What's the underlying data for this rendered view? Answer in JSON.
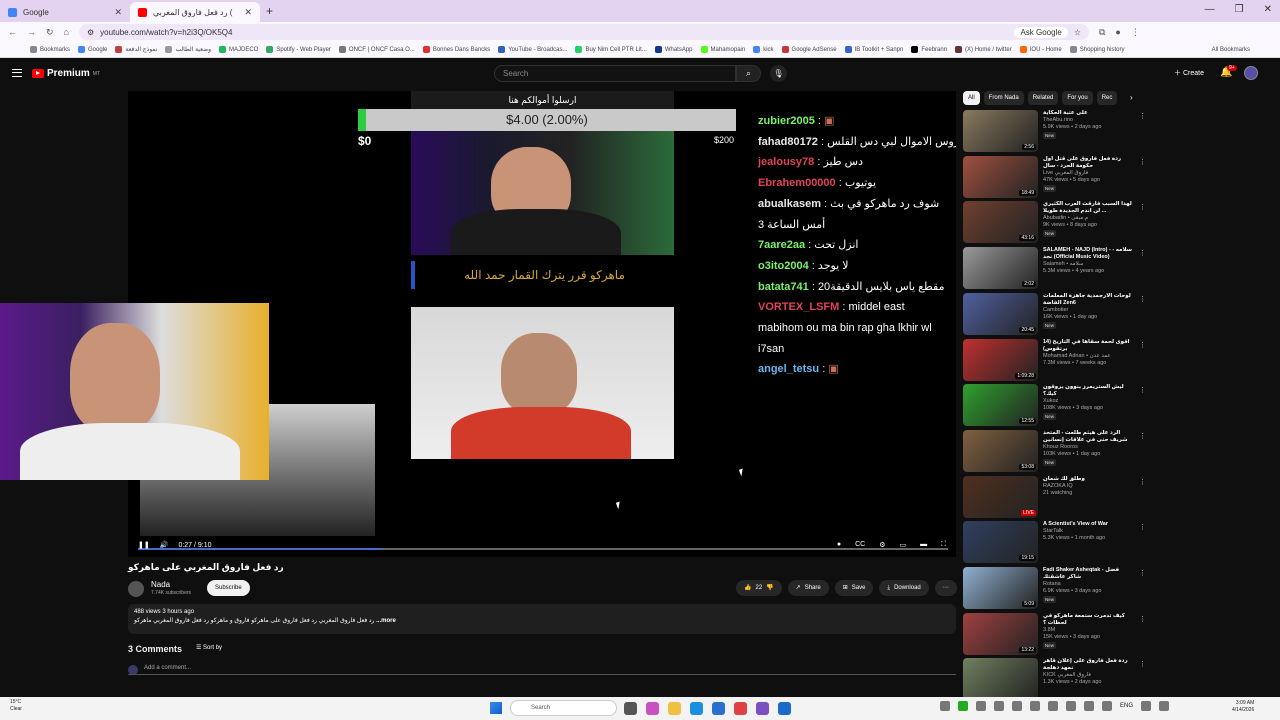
{
  "browser": {
    "tabs": [
      {
        "label": "Google"
      },
      {
        "label": "رد فعل فاروق المغربي (NOOB) -"
      }
    ],
    "url": "youtube.com/watch?v=h2i3Q/OK5Q4",
    "ask_google": "Ask Google",
    "bookmarks": [
      "Bookmarks",
      "Google",
      "نموذج الدفعة",
      "وضعية الطالب",
      "MAJDECO",
      "Spotify - Web Player",
      "ONCF | ONCF Casa O...",
      "Bonnes Dans Bancks",
      "YouTube - Broadcas...",
      "Buy Nim Cell PTR Lit...",
      "WhatsApp",
      "Mahamopain",
      "kick",
      "Google AdSense",
      "IB TooIkit + Sanpn",
      "Feebrann",
      "(X) Home / twitter",
      "IOU - Home",
      "Shopping history"
    ],
    "all_bookmarks": "All Bookmarks"
  },
  "yt": {
    "logo": "Premium",
    "logo_sup": "MT",
    "search_placeholder": "Search",
    "create": "Create",
    "notif_count": "9+"
  },
  "stream": {
    "banner": "ارسلوا أموالكم هنا",
    "donation": "$4.00 (2.00%)",
    "don_min": "$0",
    "don_max": "$200",
    "title_strip": "ماهركو قرر يترك القمار حمد الله",
    "chat": [
      {
        "user": "zubier2005",
        "msg": "",
        "color": "#7cf06a"
      },
      {
        "user": "fahad80172",
        "msg": "ياروس الاموال لبي دس القلس",
        "color": "#e8e8e8"
      },
      {
        "user": "jealousy78",
        "msg": "دس طيز",
        "color": "#e0435a"
      },
      {
        "user": "Ebrahem00000",
        "msg": "يوتيوب",
        "color": "#e0435a"
      },
      {
        "user": "abualkasem",
        "msg": "شوف رد ماهركو في بث أمس الساعة 3",
        "color": "#e8e8e8"
      },
      {
        "user": "7aare2aa",
        "msg": "انزل تحت",
        "color": "#7cf06a"
      },
      {
        "user": "o3ito2004",
        "msg": "لا يوجد",
        "color": "#7cf06a"
      },
      {
        "user": "batata741",
        "msg": "مقطع ياس بلايس الدقيقة20",
        "color": "#7cf06a"
      },
      {
        "user": "VORTEX_LSFM",
        "msg": "middel east mabihom ou ma bin rap gha lkhir wl i7san",
        "color": "#e0435a"
      },
      {
        "user": "angel_tetsu",
        "msg": "",
        "color": "#6ab4f0"
      }
    ]
  },
  "player": {
    "time": "0:27 / 9:10",
    "progress": 0.3
  },
  "video": {
    "title": "رد فعل فاروق المغربي على ماهركو",
    "channel": "Nada",
    "subs": "7.74K subscribers",
    "subscribe": "Subscribe",
    "likes": "22",
    "share": "Share",
    "save": "Save",
    "download": "Download",
    "views": "488 views  3 hours ago",
    "desc": "رد فعل فاروق المغربي رد فعل فاروق على ماهركو فاروق و ماهركو رد فعل فاروق المغربي ماهركو",
    "more": "...more",
    "comments": "3 Comments",
    "sort": "Sort by",
    "add_comment": "Add a comment..."
  },
  "chips": [
    "All",
    "From Nada",
    "Related",
    "For you",
    "Rec"
  ],
  "recs": [
    {
      "title": "على عتبة الحكاية",
      "ch": "TheAbu.rino",
      "meta": "5.9K views • 2 days ago",
      "dur": "2:56",
      "new": "New",
      "color": "#8a7a60"
    },
    {
      "title": "ردة فعل فاروق على قتل اول حكومة الحرد - سال",
      "ch": "Live فاروق المغربي",
      "meta": "47K views • 5 days ago",
      "dur": "18:49",
      "new": "New",
      "color": "#a05040"
    },
    {
      "title": "لهذا السبب فارقت العرب الكثيري ... لن اندم الجديدة طويلا",
      "ch": "Abubadin • م.مبقى",
      "meta": "9K views • 8 days ago",
      "dur": "43:16",
      "new": "New",
      "color": "#704030"
    },
    {
      "title": "SALAMEH - NAJD (Intro) - سلامه - نجد (Official Music Video)",
      "ch": "Salameh • سلامه",
      "meta": "5.3M views • 4 years ago",
      "dur": "2:02",
      "new": "",
      "color": "#9a9a9a"
    },
    {
      "title": "لوحات الأرجمدية جاهزة المعلمات الفاضة Zen6",
      "ch": "Cambotier",
      "meta": "16K views • 1 day ago",
      "dur": "20:45",
      "new": "New",
      "color": "#5060a0"
    },
    {
      "title": "أقوى لحمة سقاها في التاريخ (14 برتقوس)",
      "ch": "Mohamad Adnan • عمد عدن",
      "meta": "7.3M views • 7 weeks ago",
      "dur": "1:09:28",
      "new": "",
      "color": "#c03030"
    },
    {
      "title": "ليش الستريمرز ينوون يروقون كيك؟",
      "ch": "Xukoz",
      "meta": "108K views • 3 days ago",
      "dur": "12:55",
      "new": "New",
      "color": "#30a030"
    },
    {
      "title": "الرد على هيثم طلعت - المتحد شريف حتى في علاقات إنسانين",
      "ch": "Khouz Rooros",
      "meta": "103K views • 1 day ago",
      "dur": "53:08",
      "new": "New",
      "color": "#806040"
    },
    {
      "title": "وطلق لك شمان",
      "ch": "RAZOKA IQ",
      "meta": "21 watching",
      "dur": "LIVE",
      "new": "",
      "color": "#503020"
    },
    {
      "title": "A Scientist's View of War",
      "ch": "StarTalk",
      "meta": "5.3K views • 1 month ago",
      "dur": "19:15",
      "new": "",
      "color": "#304060"
    },
    {
      "title": "Fadi Shaker Asheqtak - فضل شاكر عاشقتك",
      "ch": "Rotana",
      "meta": "6.9K views • 3 days ago",
      "dur": "5:09",
      "new": "New",
      "color": "#90b0d0"
    },
    {
      "title": "كيف تدمرت ستمعة ماهركو في لحظات ؟",
      "ch": "3.8M",
      "meta": "15K views • 3 days ago",
      "dur": "13:22",
      "new": "New",
      "color": "#a04040"
    },
    {
      "title": "ردة فعل فاروق على إعلان قاهر نمهد دهلجة",
      "ch": "KICK فاروق المغربي",
      "meta": "1.3K views • 2 days ago",
      "dur": "",
      "new": "",
      "color": "#708060"
    }
  ],
  "taskbar": {
    "weather_temp": "15°C",
    "weather_desc": "Clear",
    "search": "Search",
    "lang": "ENG",
    "time": "3:09 AM",
    "date": "4/14/2026"
  }
}
